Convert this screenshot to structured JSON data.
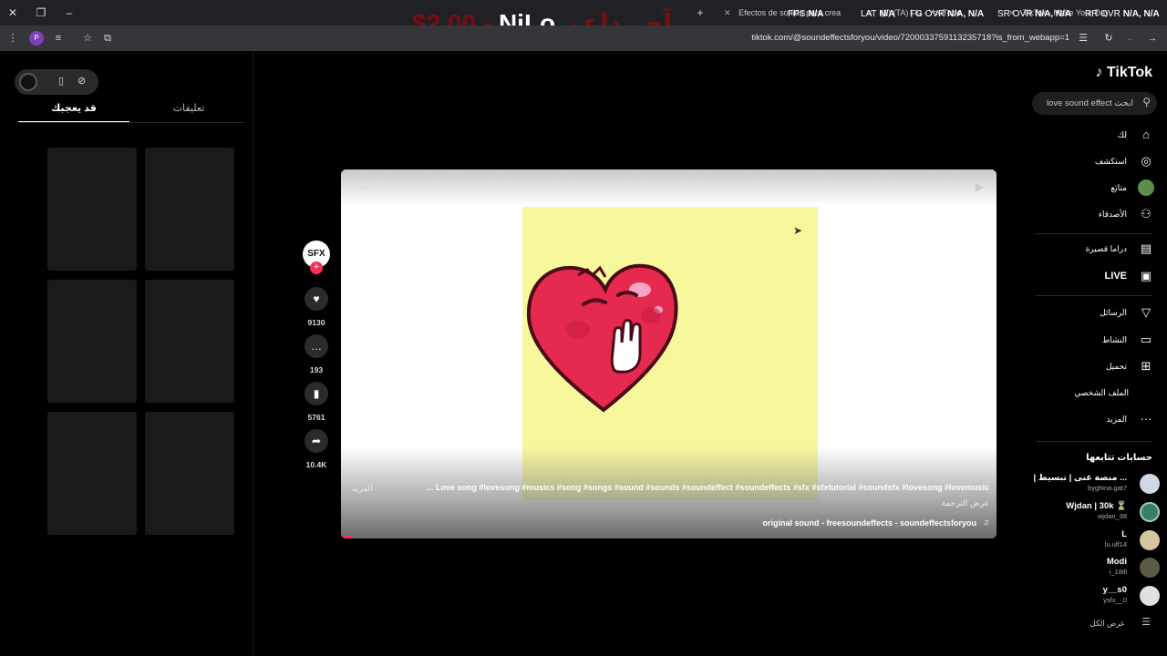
{
  "browser": {
    "tabs": [
      {
        "label": "Efectos de sonido para crea"
      },
      {
        "label": "(1) (TA) | lu - YouTube"
      },
      {
        "label": "TikTok - Make Your Day"
      }
    ],
    "overlay": {
      "price": "$2.00 -",
      "name": "NjLo",
      "arabic": "آخر داعم"
    },
    "stats": [
      {
        "label": "FPS",
        "value": "N/A"
      },
      {
        "label": "LAT",
        "value": "N/A"
      },
      {
        "label": "FG OVR",
        "value": "N/A, N/A"
      },
      {
        "label": "SR OVR",
        "value": "N/A, N/A"
      },
      {
        "label": "RR OVR",
        "value": "N/A, N/A"
      }
    ],
    "profile_letter": "P",
    "url": "tiktok.com/@soundeffectsforyou/video/7200033759113235718?is_from_webapp=1"
  },
  "left_panel": {
    "tabs": [
      {
        "label": "قد يعجبك",
        "active": true
      },
      {
        "label": "تعليقات",
        "active": false
      }
    ]
  },
  "actions": {
    "avatar_text": "SFX",
    "likes": "9130",
    "comments": "193",
    "saves": "5761",
    "shares": "10.4K"
  },
  "video": {
    "date": "9-02-2-89 · soundeffectsforyou",
    "caption": "Love song #lovesong #musics #song #songs #sound #sounds #soundeffect #soundeffects #sfx #sfxtutorial #soundsfx #lovesong #lovemusic ...",
    "more": "المزيد",
    "translate": "عرض الترجمة",
    "sound": "original sound - freesoundeffects - soundeffectsforyou"
  },
  "sidebar": {
    "logo": "TikTok",
    "search_placeholder": "love sound effect  ابحث",
    "nav": [
      {
        "label": "لك",
        "icon": "home-icon"
      },
      {
        "label": "استكشف",
        "icon": "compass-icon"
      },
      {
        "label": "متابَع",
        "icon": "following-avatar-icon"
      },
      {
        "label": "الأصدقاء",
        "icon": "friends-icon"
      },
      {
        "label": "دراما قصيرة",
        "icon": "drama-icon"
      },
      {
        "label": "LIVE",
        "icon": "live-icon"
      },
      {
        "label": "الرسائل",
        "icon": "messages-icon"
      },
      {
        "label": "النشاط",
        "icon": "activity-icon"
      },
      {
        "label": "تحميل",
        "icon": "upload-icon"
      },
      {
        "label": "الملف الشخصي",
        "icon": "profile-icon"
      },
      {
        "label": "المزيد",
        "icon": "more-icon"
      }
    ],
    "following_title": "حسابات تتابعها",
    "accounts": [
      {
        "name": "| منصة غنى | تبسيط ...",
        "handle": "byghina.gat7",
        "color": "#cfd8e6"
      },
      {
        "name": "Wjdan | 30k ⏳",
        "handle": "wjdan_38",
        "color": "#3a7f63"
      },
      {
        "name": "L",
        "handle": "lu.ulf14",
        "color": "#d6c6a0"
      },
      {
        "name": "Modi",
        "handle": "i_18ill",
        "color": "#5b5b45"
      },
      {
        "name": "y__s0",
        "handle": "ysfx__0",
        "color": "#e0e0e0"
      }
    ],
    "see_all": "عرض الكل"
  }
}
